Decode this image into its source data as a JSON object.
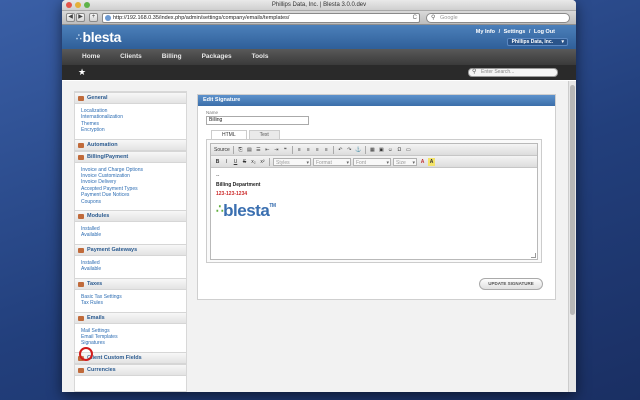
{
  "window": {
    "title": "Phillips Data, Inc. | Blesta 3.0.0.dev",
    "url": "http://192.168.0.35/index.php/admin/settings/company/emails/templates/",
    "search_placeholder": "Google",
    "back": "◀",
    "forward": "▶",
    "add": "+",
    "reload": "C",
    "search_glyph": "⚲"
  },
  "header": {
    "logo_dots": "∴",
    "logo": "blesta",
    "links": [
      "My Info",
      "Settings",
      "Log Out"
    ],
    "link_separator": "/",
    "company": "Phillips Data, Inc.",
    "company_caret": "▾"
  },
  "nav": {
    "items": [
      "Home",
      "Clients",
      "Billing",
      "Packages",
      "Tools"
    ],
    "star": "★",
    "search_placeholder": "Enter Search..."
  },
  "sidebar": {
    "sections": [
      {
        "title": "General",
        "links": [
          "Localization",
          "Internationalization",
          "Themes",
          "Encryption"
        ]
      },
      {
        "title": "Automation",
        "links": []
      },
      {
        "title": "Billing/Payment",
        "links": [
          "Invoice and Charge Options",
          "Invoice Customization",
          "Invoice Delivery",
          "Accepted Payment Types",
          "Payment Due Notices",
          "Coupons"
        ]
      },
      {
        "title": "Modules",
        "links": [
          "Installed",
          "Available"
        ]
      },
      {
        "title": "Payment Gateways",
        "links": [
          "Installed",
          "Available"
        ]
      },
      {
        "title": "Taxes",
        "links": [
          "Basic Tax Settings",
          "Tax Rules"
        ]
      },
      {
        "title": "Emails",
        "links": [
          "Mail Settings",
          "Email Templates",
          "Signatures"
        ]
      },
      {
        "title": "Client Custom Fields",
        "links": []
      },
      {
        "title": "Currencies",
        "links": []
      }
    ]
  },
  "panel": {
    "title": "Edit Signature",
    "name_label": "Name",
    "name_value": "Billing",
    "tabs": [
      "HTML",
      "Text"
    ],
    "toolbar": {
      "source": "Source",
      "row1": [
        "⎘",
        "▤",
        "☰",
        "⇤",
        "⇥",
        "❝",
        "≡",
        "≡",
        "≡",
        "≡",
        "↶",
        "↷",
        "⚓",
        "▦",
        "▣",
        "☺",
        "Ω",
        "▭"
      ],
      "row2": [
        "B",
        "I",
        "U",
        "S",
        "x₂",
        "x²"
      ],
      "styles": "Styles",
      "format": "Format",
      "font": "Font",
      "size": "Size",
      "combo_arrow": "▾",
      "text_color": "A",
      "bg_color": "A"
    },
    "body": {
      "dashes": "--",
      "department": "Billing Department",
      "phone": "123-123-1234",
      "logo_dots": "∴",
      "logo": "blesta",
      "logo_tm": "TM"
    },
    "update_button": "UPDATE SIGNATURE"
  }
}
